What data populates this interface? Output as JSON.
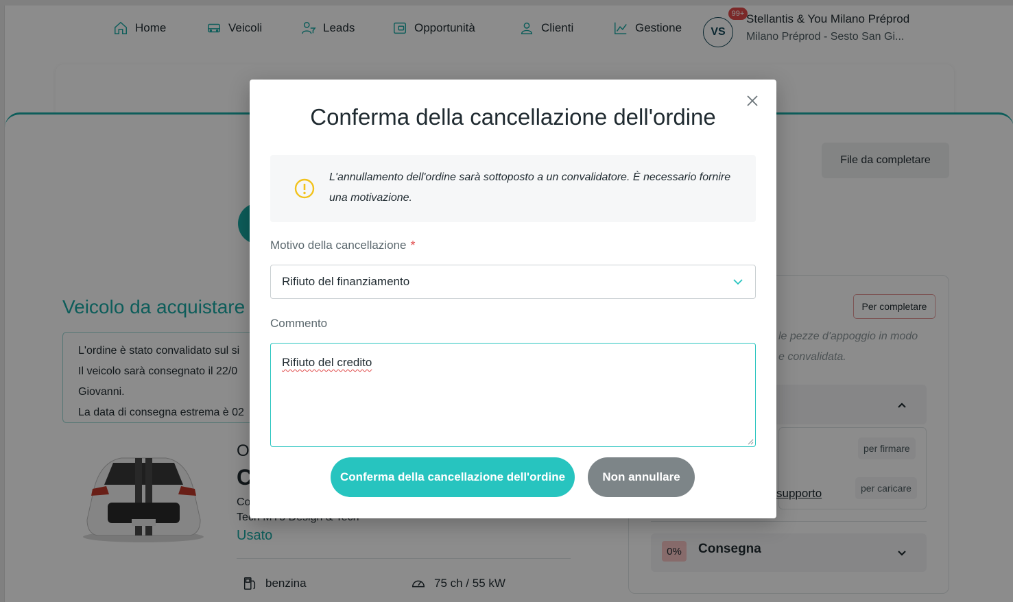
{
  "nav": {
    "items": [
      {
        "label": "Home",
        "icon": "home-icon"
      },
      {
        "label": "Veicoli",
        "icon": "car-icon"
      },
      {
        "label": "Leads",
        "icon": "user-filter-icon"
      },
      {
        "label": "Opportunità",
        "icon": "wallet-icon"
      },
      {
        "label": "Clienti",
        "icon": "user-icon"
      },
      {
        "label": "Gestione",
        "icon": "chart-line-icon"
      }
    ],
    "avatar_initials": "VS",
    "notification_count": "99+",
    "dealer_name": "Stellantis & You Milano Préprod",
    "dealer_location": "Milano Préprod - Sesto San Gi..."
  },
  "page": {
    "file_button": "File da completare",
    "vehicle_section_title": "Veicolo da acquistare",
    "order_info": {
      "line1": "L'ordine è stato convalidato sul si",
      "line2": "Il veicolo sarà consegnato il 22/0",
      "line3": "Giovanni.",
      "line4": "La data di consegna estrema è 02"
    },
    "car": {
      "model_a": "O",
      "model_b": "C",
      "desc_a": "Co",
      "desc_b": "Tech MY5 Design & Tech",
      "condition": "Usato",
      "fuel": "benzina",
      "power": "75 ch / 55 kW"
    },
    "right_panel": {
      "badge": "Per completare",
      "text1": "le pezze d'appoggio in modo",
      "text2": "e convalidata.",
      "pill_sign": "per firmare",
      "pill_upload": "per caricare",
      "link": "supporto",
      "delivery_percent": "0%",
      "delivery_label": "Consegna"
    }
  },
  "modal": {
    "title": "Conferma della cancellazione dell'ordine",
    "warning": "L'annullamento dell'ordine sarà sottoposto a un convalidatore. È necessario fornire una motivazione.",
    "reason_label": "Motivo della cancellazione",
    "reason_required_mark": "*",
    "reason_value": "Rifiuto del finanziamento",
    "comment_label": "Commento",
    "comment_value": "Rifiuto del credito",
    "confirm_button": "Conferma della cancellazione dell'ordine",
    "cancel_button": "Non annullare"
  },
  "colors": {
    "accent": "#27c4bf",
    "dark_accent": "#124657",
    "warning": "#f2c21b",
    "danger": "#e04a4a",
    "secondary_button": "#7d8588"
  }
}
